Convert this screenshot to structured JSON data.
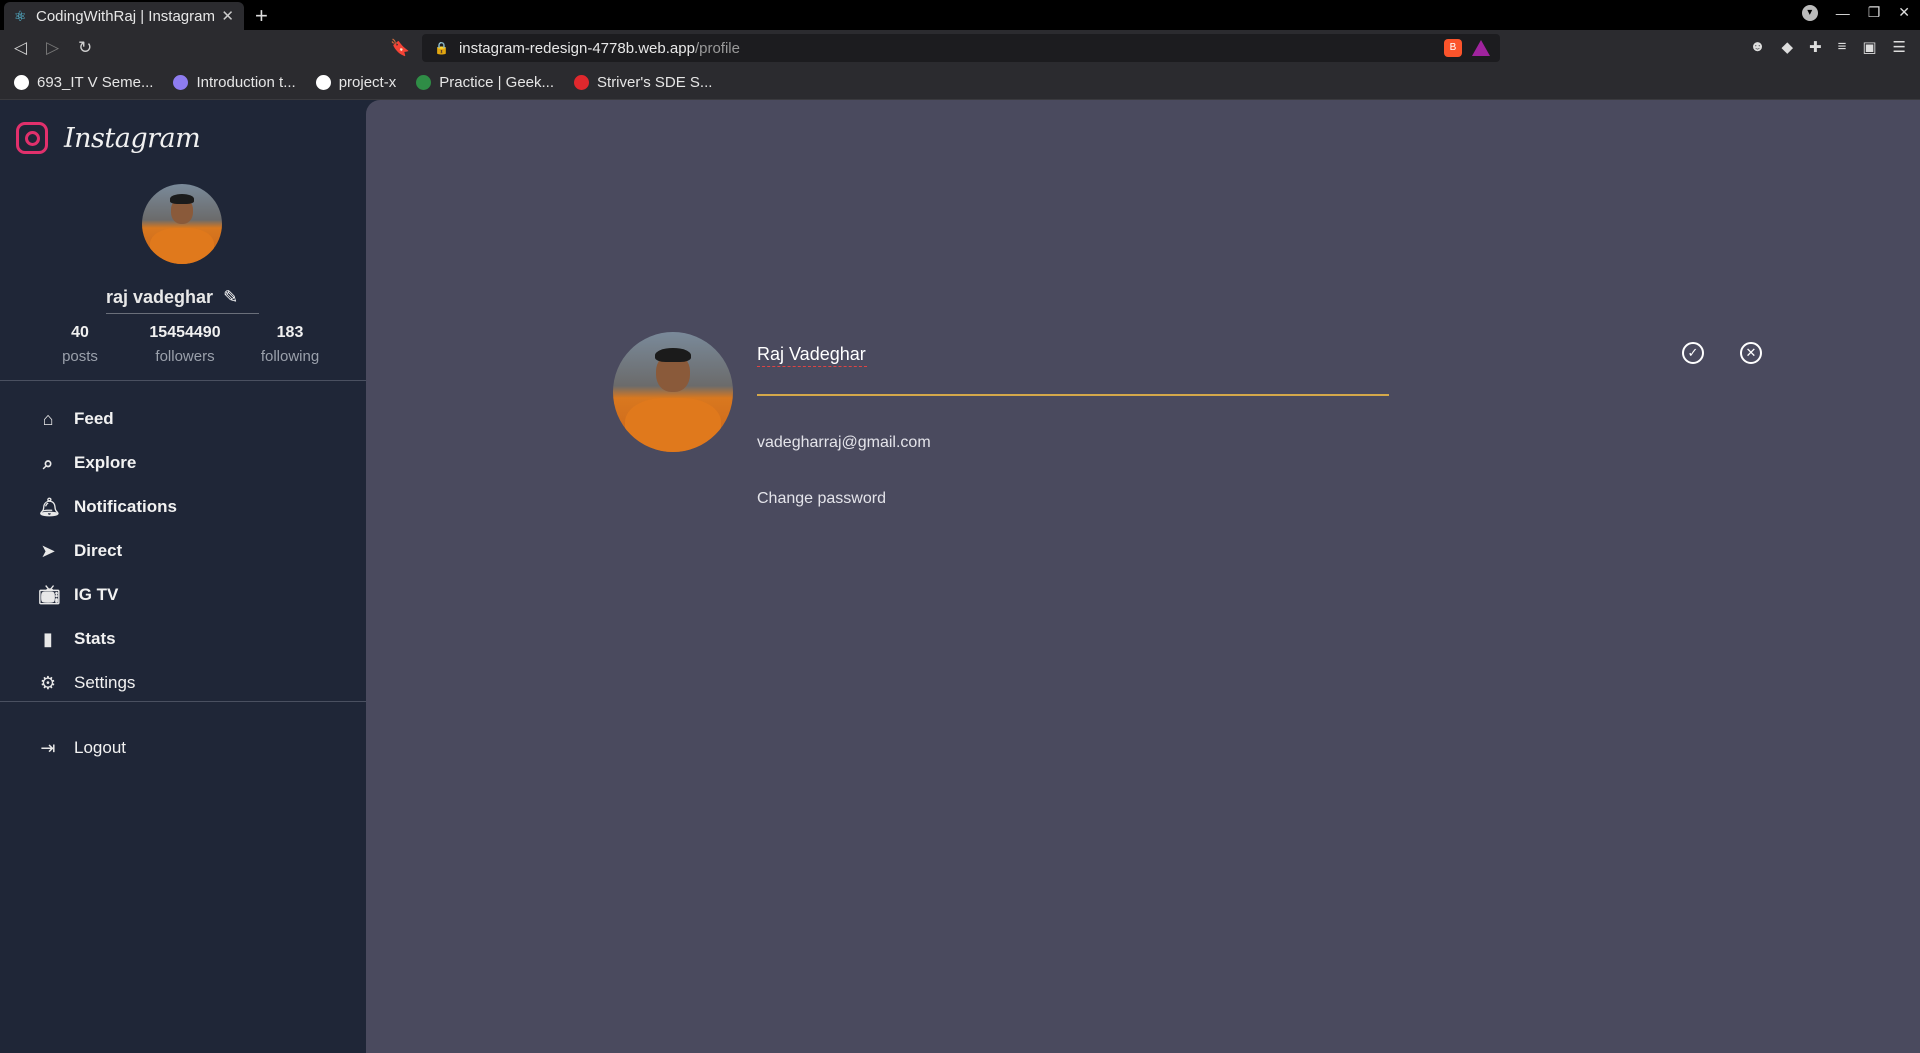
{
  "browser": {
    "tab_title": "CodingWithRaj | Instagram",
    "tab_close": "✕",
    "new_tab": "+",
    "url_host": "instagram-redesign-4778b.web.app",
    "url_path": "/profile",
    "bookmarks": [
      {
        "label": "693_IT V Seme...",
        "color": "#ffffff"
      },
      {
        "label": "Introduction t...",
        "color": "#8e7cf0"
      },
      {
        "label": "project-x",
        "color": "#ffffff"
      },
      {
        "label": "Practice | Geek...",
        "color": "#2f8d46"
      },
      {
        "label": "Striver's SDE S...",
        "color": "#e0282d"
      }
    ]
  },
  "app": {
    "brand": "Instagram",
    "accent_color": "#e1306c",
    "sidebar": {
      "username": "raj vadeghar",
      "stats": [
        {
          "value": "40",
          "label": "posts"
        },
        {
          "value": "15454490",
          "label": "followers"
        },
        {
          "value": "183",
          "label": "following"
        }
      ],
      "nav": [
        {
          "label": "Feed",
          "icon": "home-icon"
        },
        {
          "label": "Explore",
          "icon": "search-icon"
        },
        {
          "label": "Notifications",
          "icon": "bell-icon"
        },
        {
          "label": "Direct",
          "icon": "send-icon"
        },
        {
          "label": "IG TV",
          "icon": "tv-icon"
        },
        {
          "label": "Stats",
          "icon": "bar-chart-icon"
        },
        {
          "label": "Settings",
          "icon": "gear-icon"
        }
      ],
      "logout_label": "Logout"
    },
    "profile": {
      "name_value": "Raj Vadeghar",
      "email": "vadegharraj@gmail.com",
      "change_password_label": "Change password"
    }
  }
}
